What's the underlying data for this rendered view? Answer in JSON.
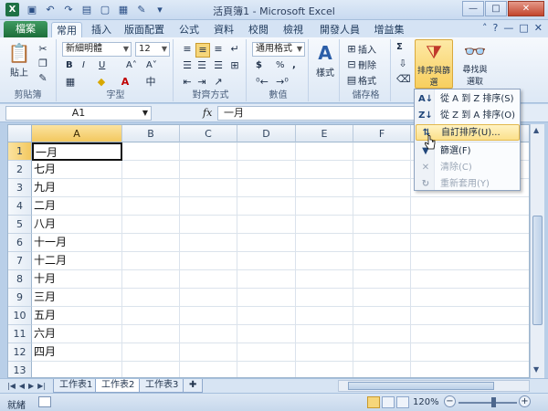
{
  "window": {
    "title": "活頁簿1 - Microsoft Excel",
    "app_icon": "X",
    "qat": [
      "save-icon",
      "undo-icon",
      "redo-icon",
      "open-icon",
      "new-icon",
      "print-preview-icon",
      "format-painter-icon",
      "customize-icon"
    ],
    "controls": {
      "minimize": "—",
      "maximize": "□",
      "close": "✕"
    }
  },
  "tabs": {
    "file": "檔案",
    "items": [
      "常用",
      "插入",
      "版面配置",
      "公式",
      "資料",
      "校閱",
      "檢視",
      "開發人員",
      "增益集"
    ],
    "active_index": 0
  },
  "ribbon": {
    "clipboard": {
      "paste": "貼上",
      "label": "剪貼簿"
    },
    "font": {
      "name": "新細明體",
      "size": "12",
      "bold": "B",
      "italic": "I",
      "underline": "U",
      "grow": "A˄",
      "shrink": "A˅",
      "label": "字型"
    },
    "alignment": {
      "label": "對齊方式"
    },
    "number": {
      "format": "通用格式",
      "currency": "$",
      "percent": "%",
      "comma": ",",
      "label": "數值"
    },
    "styles": {
      "label": "樣式",
      "button": "樣式"
    },
    "cells": {
      "insert": "插入",
      "delete": "刪除",
      "format": "格式",
      "label": "儲存格"
    },
    "editing": {
      "sum": "Σ",
      "sort_filter": "排序與篩選",
      "find_select_1": "尋找與",
      "find_select_2": "選取"
    }
  },
  "formula_bar": {
    "name_box": "A1",
    "fx": "fx",
    "value": "一月"
  },
  "grid": {
    "columns": [
      "A",
      "B",
      "C",
      "D",
      "E",
      "F"
    ],
    "selected_column": "A",
    "rows": [
      {
        "num": "1",
        "a": "一月"
      },
      {
        "num": "2",
        "a": "七月"
      },
      {
        "num": "3",
        "a": "九月"
      },
      {
        "num": "4",
        "a": "二月"
      },
      {
        "num": "5",
        "a": "八月"
      },
      {
        "num": "6",
        "a": "十一月"
      },
      {
        "num": "7",
        "a": "十二月"
      },
      {
        "num": "8",
        "a": "十月"
      },
      {
        "num": "9",
        "a": "三月"
      },
      {
        "num": "10",
        "a": "五月"
      },
      {
        "num": "11",
        "a": "六月"
      },
      {
        "num": "12",
        "a": "四月"
      },
      {
        "num": "13",
        "a": ""
      }
    ]
  },
  "sheets": {
    "tabs": [
      "工作表1",
      "工作表2",
      "工作表3"
    ],
    "active_index": 1
  },
  "status": {
    "ready": "就緒",
    "zoom": "120%"
  },
  "sort_menu": {
    "items": [
      {
        "label": "從 A 到 Z 排序(S)",
        "icon": "sort-az-icon",
        "glyph": "A↓",
        "state": "normal"
      },
      {
        "label": "從 Z 到 A 排序(O)",
        "icon": "sort-za-icon",
        "glyph": "Z↓",
        "state": "normal"
      },
      {
        "label": "自訂排序(U)...",
        "icon": "custom-sort-icon",
        "glyph": "⇅",
        "state": "hover"
      },
      {
        "label": "篩選(F)",
        "icon": "filter-icon",
        "glyph": "▼",
        "state": "normal"
      },
      {
        "label": "清除(C)",
        "icon": "clear-filter-icon",
        "glyph": "✕",
        "state": "disabled"
      },
      {
        "label": "重新套用(Y)",
        "icon": "reapply-icon",
        "glyph": "↻",
        "state": "disabled"
      }
    ]
  }
}
